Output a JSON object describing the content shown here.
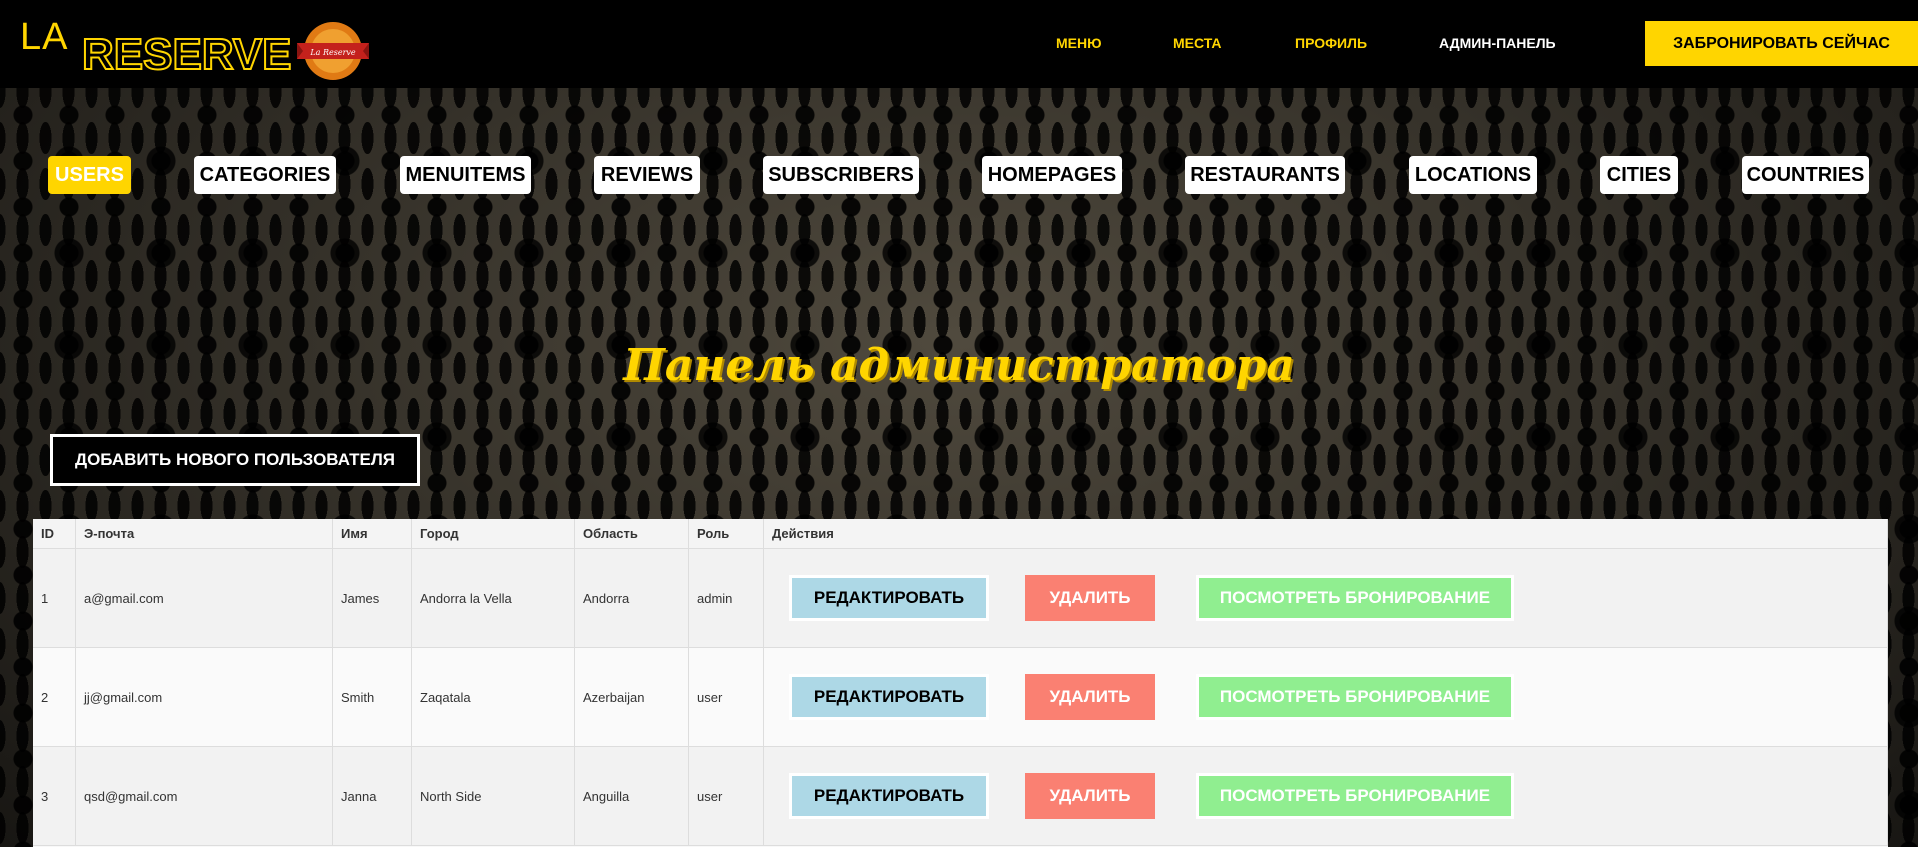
{
  "header": {
    "logo_la": "LA",
    "logo_reserve": "RESERVE",
    "badge_text": "La Reserve",
    "nav": [
      {
        "label": "МЕНЮ",
        "color": "#ffd500"
      },
      {
        "label": "МЕСТА",
        "color": "#ffd500"
      },
      {
        "label": "ПРОФИЛЬ",
        "color": "#ffd500"
      },
      {
        "label": "АДМИН-ПАНЕЛЬ",
        "color": "#ffffff"
      }
    ],
    "book_button": "ЗАБРОНИРОВАТЬ СЕЙЧАС"
  },
  "tabs": [
    {
      "label": "USERS",
      "active": true
    },
    {
      "label": "CATEGORIES"
    },
    {
      "label": "MENUITEMS"
    },
    {
      "label": "REVIEWS"
    },
    {
      "label": "SUBSCRIBERS"
    },
    {
      "label": "HOMEPAGES"
    },
    {
      "label": "RESTAURANTS"
    },
    {
      "label": "LOCATIONS"
    },
    {
      "label": "CITIES"
    },
    {
      "label": "COUNTRIES"
    }
  ],
  "page_title": "Панель администратора",
  "add_button": "ДОБАВИТЬ НОВОГО ПОЛЬЗОВАТЕЛЯ",
  "table": {
    "headers": [
      "ID",
      "Э-почта",
      "Имя",
      "Город",
      "Область",
      "Роль",
      "Действия"
    ],
    "rows": [
      {
        "id": "1",
        "email": "a@gmail.com",
        "name": "James",
        "city": "Andorra la Vella",
        "region": "Andorra",
        "role": "admin"
      },
      {
        "id": "2",
        "email": "jj@gmail.com",
        "name": "Smith",
        "city": "Zaqatala",
        "region": "Azerbaijan",
        "role": "user"
      },
      {
        "id": "3",
        "email": "qsd@gmail.com",
        "name": "Janna",
        "city": "North Side",
        "region": "Anguilla",
        "role": "user"
      }
    ],
    "actions": {
      "edit": "РЕДАКТИРОВАТЬ",
      "delete": "УДАЛИТЬ",
      "view": "ПОСМОТРЕТЬ БРОНИРОВАНИЕ"
    }
  },
  "colors": {
    "accent": "#ffd500",
    "edit": "#add8e6",
    "delete": "#fa8072",
    "view": "#90ee90"
  }
}
